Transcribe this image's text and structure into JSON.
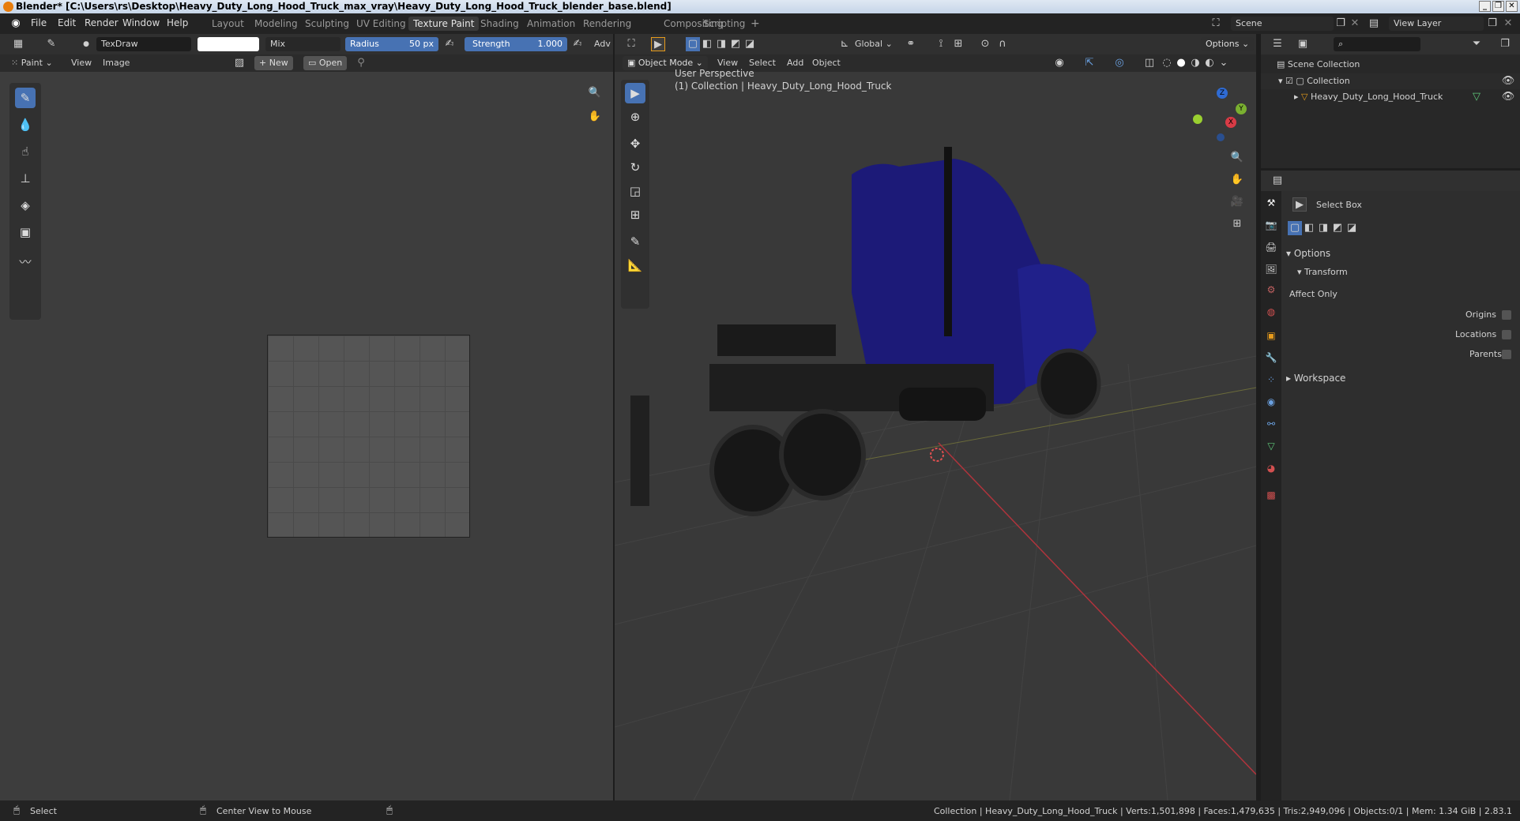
{
  "window": {
    "title": "Blender* [C:\\Users\\rs\\Desktop\\Heavy_Duty_Long_Hood_Truck_max_vray\\Heavy_Duty_Long_Hood_Truck_blender_base.blend]"
  },
  "menus": [
    "File",
    "Edit",
    "Render",
    "Window",
    "Help"
  ],
  "workspaces": [
    "Layout",
    "Modeling",
    "Sculpting",
    "UV Editing",
    "Texture Paint",
    "Shading",
    "Animation",
    "Rendering",
    "Compositing",
    "Scripting"
  ],
  "scene": {
    "label": "Scene",
    "view_layer": "View Layer"
  },
  "brush": {
    "name": "TexDraw",
    "color": "#ffffff",
    "blend": "Mix",
    "radius_label": "Radius",
    "radius_value": "50 px",
    "strength_label": "Strength",
    "strength_value": "1.000",
    "adv": "Adv"
  },
  "image_editor": {
    "mode": "Paint",
    "view": "View",
    "image": "Image",
    "new": "New",
    "open": "Open"
  },
  "viewport": {
    "orientation": "Global",
    "options": "Options",
    "mode": "Object Mode",
    "menu": [
      "View",
      "Select",
      "Add",
      "Object"
    ],
    "perspective": "User Perspective",
    "collection_info": "(1) Collection | Heavy_Duty_Long_Hood_Truck",
    "gizmo": {
      "x": "X",
      "y": "Y",
      "z": "Z"
    },
    "truck_color": "#1c1a78"
  },
  "outliner": {
    "scene_collection": "Scene Collection",
    "collection": "Collection",
    "object": "Heavy_Duty_Long_Hood_Truck"
  },
  "properties": {
    "tool": "Select Box",
    "options": "Options",
    "transform": "Transform",
    "affect_only": "Affect Only",
    "origins": "Origins",
    "locations": "Locations",
    "parents": "Parents",
    "workspace": "Workspace"
  },
  "statusbar": {
    "select": "Select",
    "center": "Center View to Mouse",
    "stats": "Collection | Heavy_Duty_Long_Hood_Truck | Verts:1,501,898 | Faces:1,479,635 | Tris:2,949,096 | Objects:0/1 | Mem: 1.34 GiB | 2.83.1"
  }
}
